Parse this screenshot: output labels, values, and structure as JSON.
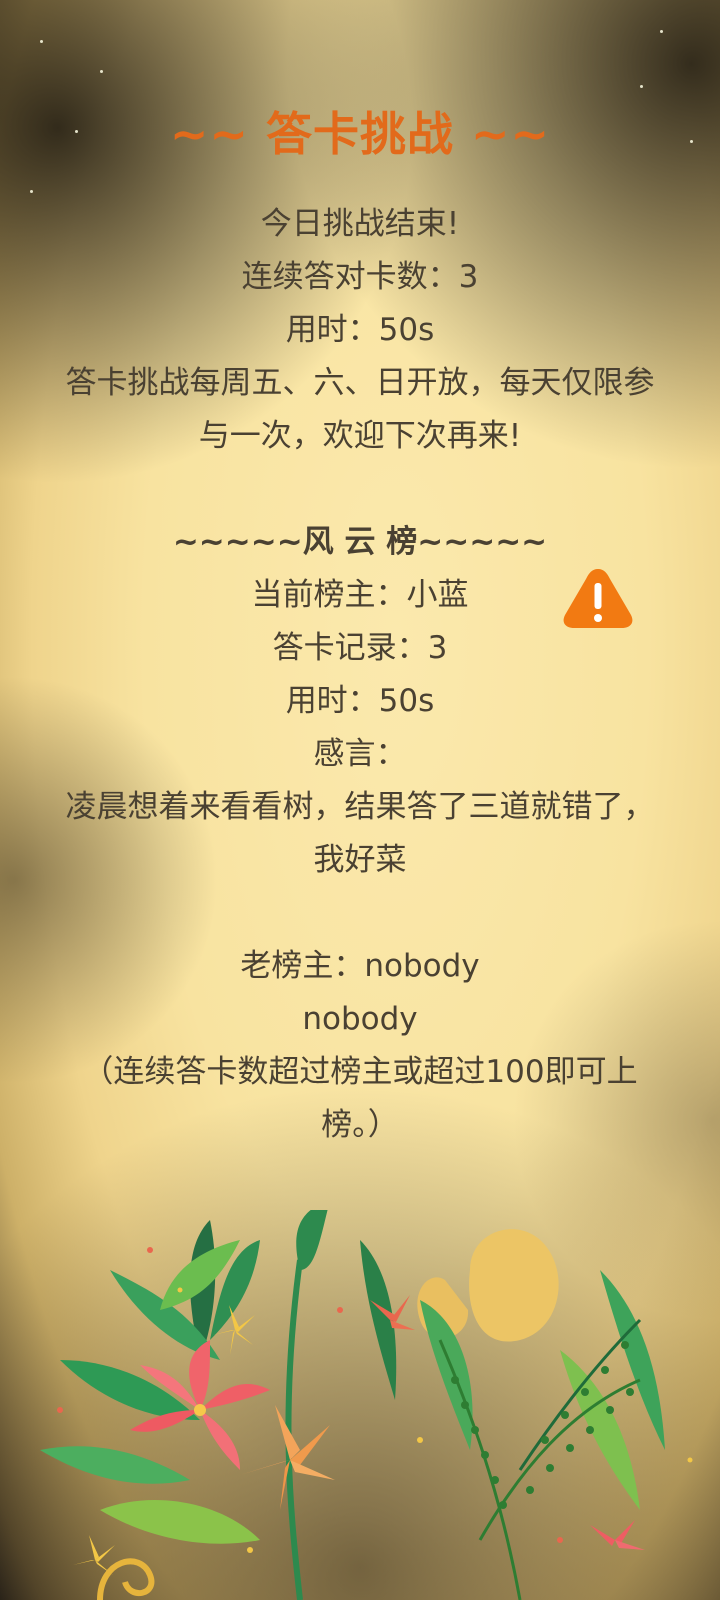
{
  "header": {
    "title": "~~ 答卡挑战 ~~"
  },
  "result": {
    "line1": "今日挑战结束!",
    "line2": "连续答对卡数：3",
    "line3": "用时：50s",
    "notice": "答卡挑战每周五、六、日开放，每天仅限参与一次，欢迎下次再来!"
  },
  "leaderboard": {
    "heading": "~~~~~风 云 榜~~~~~",
    "current_leader": "当前榜主：小蓝",
    "record": "答卡记录：3",
    "time": "用时：50s",
    "remarks_label": "感言：",
    "remarks": "凌晨想着来看看树，结果答了三道就错了，我好菜",
    "old_leader": "老榜主：nobody",
    "old_leader_name": "nobody",
    "rule": "（连续答卡数超过榜主或超过100即可上榜。）"
  },
  "colors": {
    "title": "#e26a1b",
    "text": "#4a4132",
    "warning": "#f27a12",
    "background": "#f8e3a0"
  },
  "icons": {
    "warning": "warning-icon"
  }
}
